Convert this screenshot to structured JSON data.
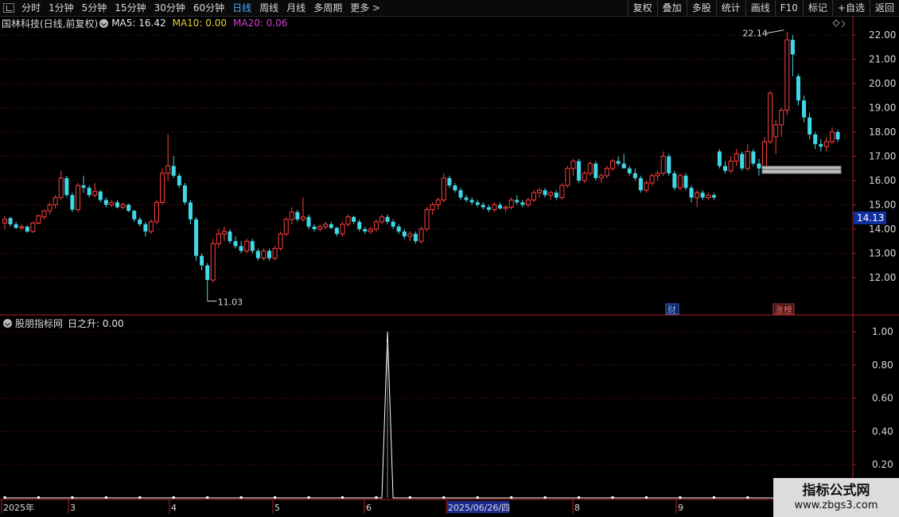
{
  "toolbar": {
    "left": [
      "分时",
      "1分钟",
      "5分钟",
      "15分钟",
      "30分钟",
      "60分钟",
      "日线",
      "周线",
      "月线",
      "多周期",
      "更多 >"
    ],
    "active": "日线",
    "right": [
      "复权",
      "叠加",
      "多股",
      "统计",
      "画线",
      "F10",
      "标记",
      "+自选",
      "返回"
    ]
  },
  "main_header": {
    "stock": "国林科技(日线,前复权)",
    "ma5": "MA5: 16.42",
    "ma10": "MA10: 0.00",
    "ma20": "MA20: 0.06",
    "colors": {
      "stock": "#d8d8d8",
      "ma5": "#e8e8e8",
      "ma10": "#e8d038",
      "ma20": "#d040d0"
    }
  },
  "indicator_header": {
    "name": "股朋指标网",
    "value": "日之升: 0.00"
  },
  "annotations": {
    "high_label": "22.14",
    "low_label": "11.03",
    "current_price": "14.13",
    "badge_cai": "财",
    "badge_zhangbang": "涨榜"
  },
  "axis": {
    "price_ticks": [
      "22.00",
      "21.00",
      "20.00",
      "19.00",
      "18.00",
      "17.00",
      "16.00",
      "15.00",
      "14.00",
      "13.00",
      "12.00"
    ],
    "indicator_ticks": [
      "1.00",
      "0.80",
      "0.60",
      "0.40",
      "0.20"
    ],
    "date_labels": [
      "2025年",
      "3",
      "4",
      "5",
      "6",
      "2025/06/26/四",
      "8",
      "9"
    ]
  },
  "watermark": {
    "title": "指标公式网",
    "url": "www.zbgs3.com"
  },
  "colors": {
    "up": "#ff4040",
    "down": "#40d8e8",
    "grid": "#7a1010",
    "axis": "#b02020",
    "background": "#000000"
  },
  "chart_data": {
    "type": "candlestick",
    "ylim": [
      11.0,
      22.3
    ],
    "candles": [
      [
        14.25,
        14.55,
        14.0,
        14.4
      ],
      [
        14.45,
        14.5,
        14.1,
        14.2
      ],
      [
        14.2,
        14.3,
        14.0,
        14.05
      ],
      [
        14.05,
        14.2,
        13.95,
        14.1
      ],
      [
        14.1,
        14.15,
        13.85,
        13.9
      ],
      [
        13.9,
        14.3,
        13.85,
        14.25
      ],
      [
        14.25,
        14.6,
        14.2,
        14.55
      ],
      [
        14.5,
        14.8,
        14.4,
        14.75
      ],
      [
        14.75,
        15.1,
        14.6,
        15.0
      ],
      [
        15.0,
        15.4,
        14.85,
        15.3
      ],
      [
        15.3,
        16.4,
        15.2,
        16.1
      ],
      [
        16.1,
        16.2,
        15.3,
        15.4
      ],
      [
        15.4,
        15.5,
        14.7,
        14.8
      ],
      [
        14.8,
        15.9,
        14.7,
        15.8
      ],
      [
        15.8,
        16.2,
        15.5,
        15.7
      ],
      [
        15.7,
        15.8,
        15.3,
        15.4
      ],
      [
        15.4,
        15.9,
        15.3,
        15.55
      ],
      [
        15.55,
        15.6,
        15.1,
        15.2
      ],
      [
        15.2,
        15.3,
        14.9,
        15.0
      ],
      [
        15.0,
        15.2,
        14.9,
        15.1
      ],
      [
        15.1,
        15.2,
        14.85,
        14.9
      ],
      [
        14.9,
        15.1,
        14.8,
        15.0
      ],
      [
        15.0,
        15.05,
        14.7,
        14.75
      ],
      [
        14.75,
        14.8,
        14.3,
        14.4
      ],
      [
        14.4,
        14.5,
        14.1,
        14.2
      ],
      [
        14.2,
        14.3,
        13.7,
        13.9
      ],
      [
        13.9,
        14.4,
        13.8,
        14.3
      ],
      [
        14.3,
        15.2,
        14.2,
        15.1
      ],
      [
        15.1,
        16.5,
        15.0,
        16.3
      ],
      [
        16.3,
        17.9,
        16.0,
        16.6
      ],
      [
        16.6,
        17.0,
        16.1,
        16.2
      ],
      [
        16.2,
        16.3,
        15.7,
        15.8
      ],
      [
        15.8,
        15.9,
        15.0,
        15.1
      ],
      [
        15.1,
        15.2,
        14.2,
        14.4
      ],
      [
        14.4,
        14.5,
        12.7,
        12.9
      ],
      [
        12.9,
        13.0,
        12.3,
        12.5
      ],
      [
        12.5,
        12.6,
        11.03,
        11.9
      ],
      [
        11.9,
        13.6,
        11.8,
        13.4
      ],
      [
        13.4,
        14.0,
        13.2,
        13.8
      ],
      [
        13.8,
        14.1,
        13.5,
        13.9
      ],
      [
        13.9,
        14.0,
        13.4,
        13.5
      ],
      [
        13.5,
        13.7,
        13.2,
        13.3
      ],
      [
        13.3,
        13.5,
        13.0,
        13.1
      ],
      [
        13.1,
        13.6,
        13.0,
        13.5
      ],
      [
        13.5,
        13.6,
        13.0,
        13.1
      ],
      [
        13.1,
        13.2,
        12.7,
        12.8
      ],
      [
        12.8,
        13.2,
        12.7,
        13.1
      ],
      [
        13.1,
        13.2,
        12.7,
        12.8
      ],
      [
        12.8,
        13.3,
        12.7,
        13.2
      ],
      [
        13.2,
        13.9,
        13.1,
        13.8
      ],
      [
        13.8,
        14.5,
        13.7,
        14.4
      ],
      [
        14.4,
        14.9,
        14.2,
        14.7
      ],
      [
        14.7,
        14.8,
        14.3,
        14.4
      ],
      [
        14.4,
        15.3,
        14.3,
        14.5
      ],
      [
        14.5,
        14.6,
        14.0,
        14.1
      ],
      [
        14.1,
        14.2,
        13.9,
        14.0
      ],
      [
        14.0,
        14.2,
        13.9,
        14.1
      ],
      [
        14.1,
        14.3,
        14.0,
        14.2
      ],
      [
        14.2,
        14.3,
        14.0,
        14.05
      ],
      [
        14.05,
        14.1,
        13.7,
        13.8
      ],
      [
        13.8,
        14.3,
        13.7,
        14.2
      ],
      [
        14.2,
        14.6,
        14.1,
        14.5
      ],
      [
        14.5,
        14.55,
        14.2,
        14.3
      ],
      [
        14.3,
        14.4,
        13.9,
        14.0
      ],
      [
        14.0,
        14.1,
        13.8,
        13.9
      ],
      [
        13.9,
        14.1,
        13.8,
        14.0
      ],
      [
        14.0,
        14.4,
        13.9,
        14.3
      ],
      [
        14.3,
        14.6,
        14.2,
        14.5
      ],
      [
        14.5,
        14.6,
        14.2,
        14.3
      ],
      [
        14.3,
        14.4,
        14.0,
        14.1
      ],
      [
        14.1,
        14.2,
        13.8,
        13.9
      ],
      [
        13.9,
        14.0,
        13.6,
        13.7
      ],
      [
        13.7,
        13.9,
        13.5,
        13.8
      ],
      [
        13.8,
        13.9,
        13.4,
        13.5
      ],
      [
        13.5,
        14.1,
        13.4,
        14.0
      ],
      [
        14.0,
        14.9,
        13.9,
        14.8
      ],
      [
        14.8,
        15.1,
        14.6,
        15.0
      ],
      [
        15.0,
        15.3,
        14.8,
        15.2
      ],
      [
        15.2,
        16.3,
        15.1,
        16.1
      ],
      [
        16.1,
        16.2,
        15.7,
        15.8
      ],
      [
        15.8,
        15.9,
        15.5,
        15.6
      ],
      [
        15.6,
        15.7,
        15.2,
        15.3
      ],
      [
        15.3,
        15.4,
        15.1,
        15.2
      ],
      [
        15.2,
        15.3,
        15.0,
        15.1
      ],
      [
        15.1,
        15.2,
        14.9,
        15.0
      ],
      [
        15.0,
        15.1,
        14.8,
        14.9
      ],
      [
        14.9,
        15.0,
        14.7,
        14.8
      ],
      [
        14.8,
        15.1,
        14.7,
        15.0
      ],
      [
        15.0,
        15.1,
        14.8,
        14.85
      ],
      [
        14.85,
        15.0,
        14.7,
        14.9
      ],
      [
        14.9,
        15.3,
        14.8,
        15.2
      ],
      [
        15.2,
        15.4,
        15.0,
        15.1
      ],
      [
        15.1,
        15.2,
        14.9,
        15.0
      ],
      [
        15.0,
        15.3,
        14.9,
        15.2
      ],
      [
        15.2,
        15.6,
        15.1,
        15.5
      ],
      [
        15.5,
        15.7,
        15.3,
        15.6
      ],
      [
        15.6,
        15.7,
        15.3,
        15.4
      ],
      [
        15.4,
        15.6,
        15.2,
        15.5
      ],
      [
        15.5,
        15.6,
        15.2,
        15.3
      ],
      [
        15.3,
        15.9,
        15.2,
        15.8
      ],
      [
        15.8,
        16.6,
        15.7,
        16.5
      ],
      [
        16.5,
        16.9,
        16.2,
        16.8
      ],
      [
        16.8,
        16.9,
        15.9,
        16.0
      ],
      [
        16.0,
        16.4,
        15.9,
        16.3
      ],
      [
        16.3,
        16.8,
        16.2,
        16.7
      ],
      [
        16.7,
        16.8,
        16.0,
        16.1
      ],
      [
        16.1,
        16.3,
        15.9,
        16.2
      ],
      [
        16.2,
        16.6,
        16.1,
        16.5
      ],
      [
        16.5,
        16.9,
        16.4,
        16.8
      ],
      [
        16.8,
        17.0,
        16.6,
        16.7
      ],
      [
        16.7,
        17.1,
        16.5,
        16.5
      ],
      [
        16.5,
        16.6,
        16.2,
        16.3
      ],
      [
        16.3,
        16.5,
        16.0,
        16.1
      ],
      [
        16.1,
        16.2,
        15.5,
        15.6
      ],
      [
        15.6,
        16.0,
        15.5,
        15.9
      ],
      [
        15.9,
        16.3,
        15.8,
        16.2
      ],
      [
        16.2,
        16.4,
        16.0,
        16.3
      ],
      [
        16.3,
        17.2,
        16.2,
        17.0
      ],
      [
        17.0,
        17.1,
        16.2,
        16.3
      ],
      [
        16.3,
        16.4,
        15.6,
        15.7
      ],
      [
        15.7,
        16.3,
        15.6,
        16.2
      ],
      [
        16.2,
        16.3,
        15.6,
        15.7
      ],
      [
        15.7,
        15.8,
        15.1,
        15.3
      ],
      [
        15.3,
        15.6,
        14.9,
        15.5
      ],
      [
        15.5,
        15.6,
        15.2,
        15.3
      ],
      [
        15.3,
        15.5,
        15.2,
        15.4
      ],
      [
        15.4,
        15.5,
        15.2,
        15.3
      ],
      [
        17.2,
        17.3,
        16.5,
        16.6
      ],
      [
        16.6,
        16.8,
        16.3,
        16.4
      ],
      [
        16.4,
        17.0,
        16.3,
        16.8
      ],
      [
        16.8,
        17.3,
        16.6,
        17.1
      ],
      [
        17.1,
        17.2,
        16.4,
        16.5
      ],
      [
        16.5,
        17.5,
        16.4,
        17.2
      ],
      [
        17.2,
        17.3,
        16.6,
        16.7
      ],
      [
        16.7,
        16.9,
        16.2,
        16.5
      ],
      [
        16.5,
        17.8,
        16.4,
        17.6
      ],
      [
        17.6,
        19.7,
        17.5,
        19.6
      ],
      [
        17.8,
        18.5,
        17.1,
        18.3
      ],
      [
        18.3,
        19.0,
        17.8,
        18.9
      ],
      [
        18.9,
        22.14,
        18.7,
        21.8
      ],
      [
        21.8,
        22.0,
        20.3,
        21.2
      ],
      [
        20.3,
        20.4,
        19.1,
        19.3
      ],
      [
        19.3,
        19.5,
        18.4,
        18.6
      ],
      [
        18.6,
        18.8,
        17.7,
        17.9
      ],
      [
        17.9,
        18.0,
        17.3,
        17.5
      ],
      [
        17.5,
        17.7,
        17.2,
        17.4
      ],
      [
        17.4,
        17.8,
        17.2,
        17.6
      ],
      [
        17.6,
        18.2,
        17.5,
        18.0
      ],
      [
        18.0,
        18.1,
        17.6,
        17.7
      ]
    ],
    "indicator": {
      "peak_index": 68,
      "peak_value": 1.0,
      "ylim": [
        0,
        1.05
      ]
    }
  }
}
